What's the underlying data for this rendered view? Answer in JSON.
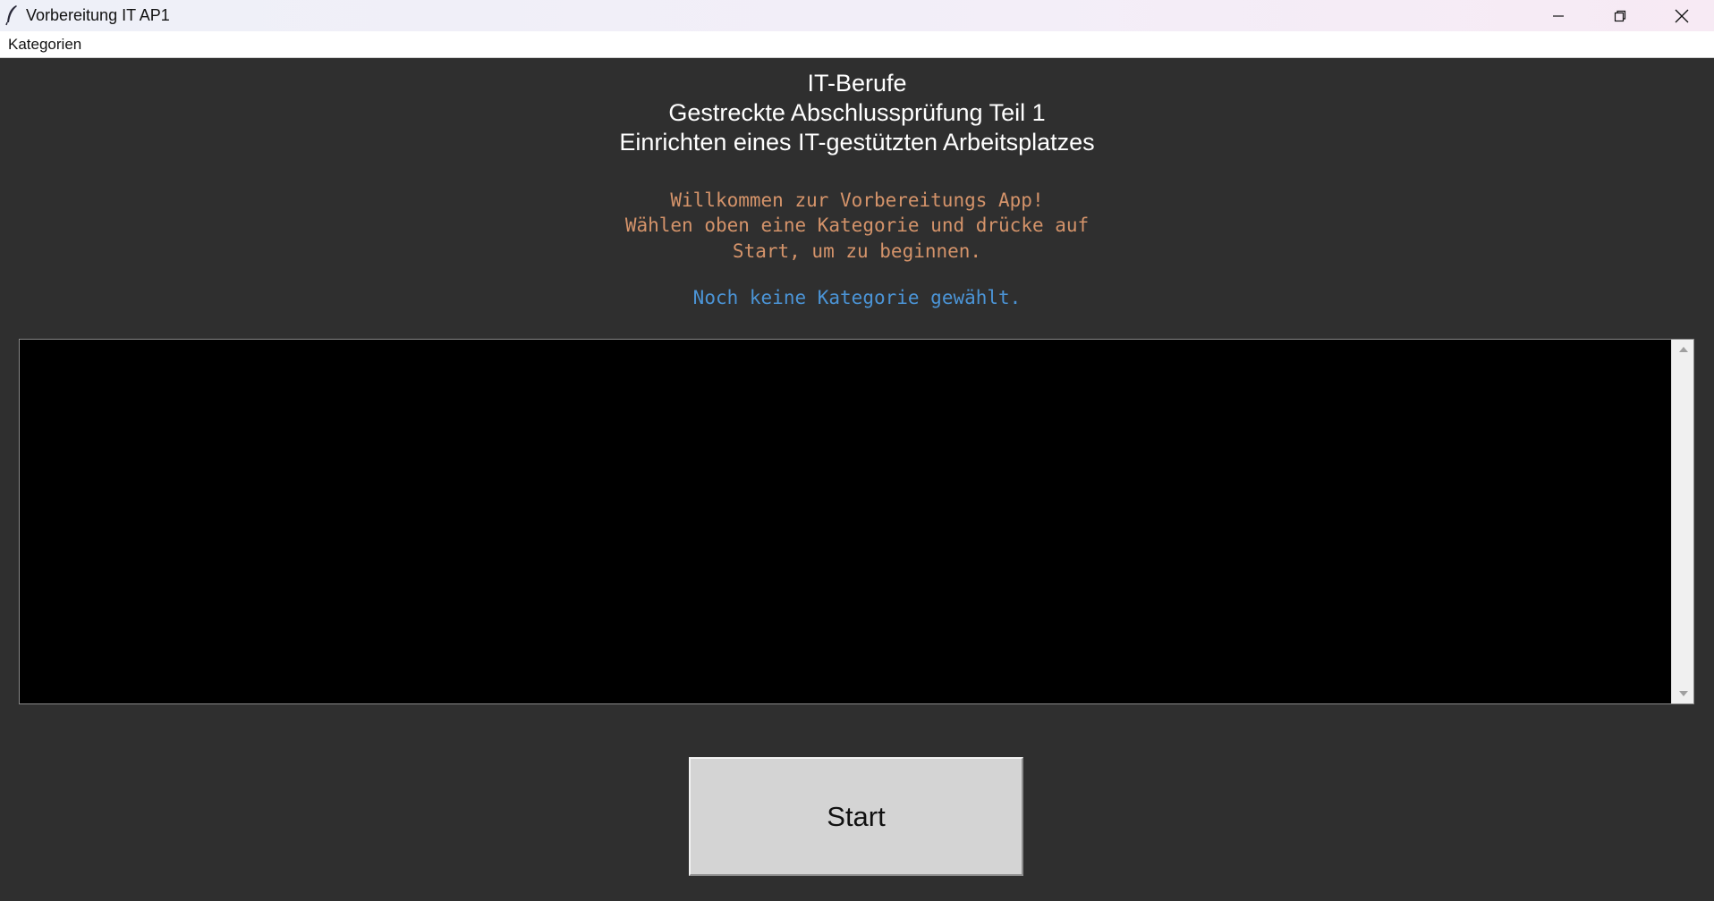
{
  "window": {
    "title": "Vorbereitung IT AP1",
    "controls": {
      "minimize": "minimize-icon",
      "maximize": "restore-icon",
      "close": "close-icon"
    }
  },
  "menu": {
    "items": [
      {
        "label": "Kategorien"
      }
    ]
  },
  "header": {
    "line1": "IT-Berufe",
    "line2": "Gestreckte Abschlussprüfung Teil 1",
    "line3": "Einrichten eines IT-gestützten Arbeitsplatzes"
  },
  "welcome": {
    "line1": "Willkommen zur Vorbereitungs App!",
    "line2": "Wählen oben eine Kategorie und drücke auf",
    "line3": "Start, um zu beginnen."
  },
  "status": {
    "text": "Noch keine Kategorie gewählt."
  },
  "output": {
    "content": ""
  },
  "actions": {
    "start_label": "Start"
  },
  "colors": {
    "background": "#2f2f2f",
    "heading_text": "#ffffff",
    "welcome_text": "#d4936a",
    "status_text": "#4b94d6",
    "textarea_bg": "#000000",
    "button_bg": "#d4d4d4"
  }
}
